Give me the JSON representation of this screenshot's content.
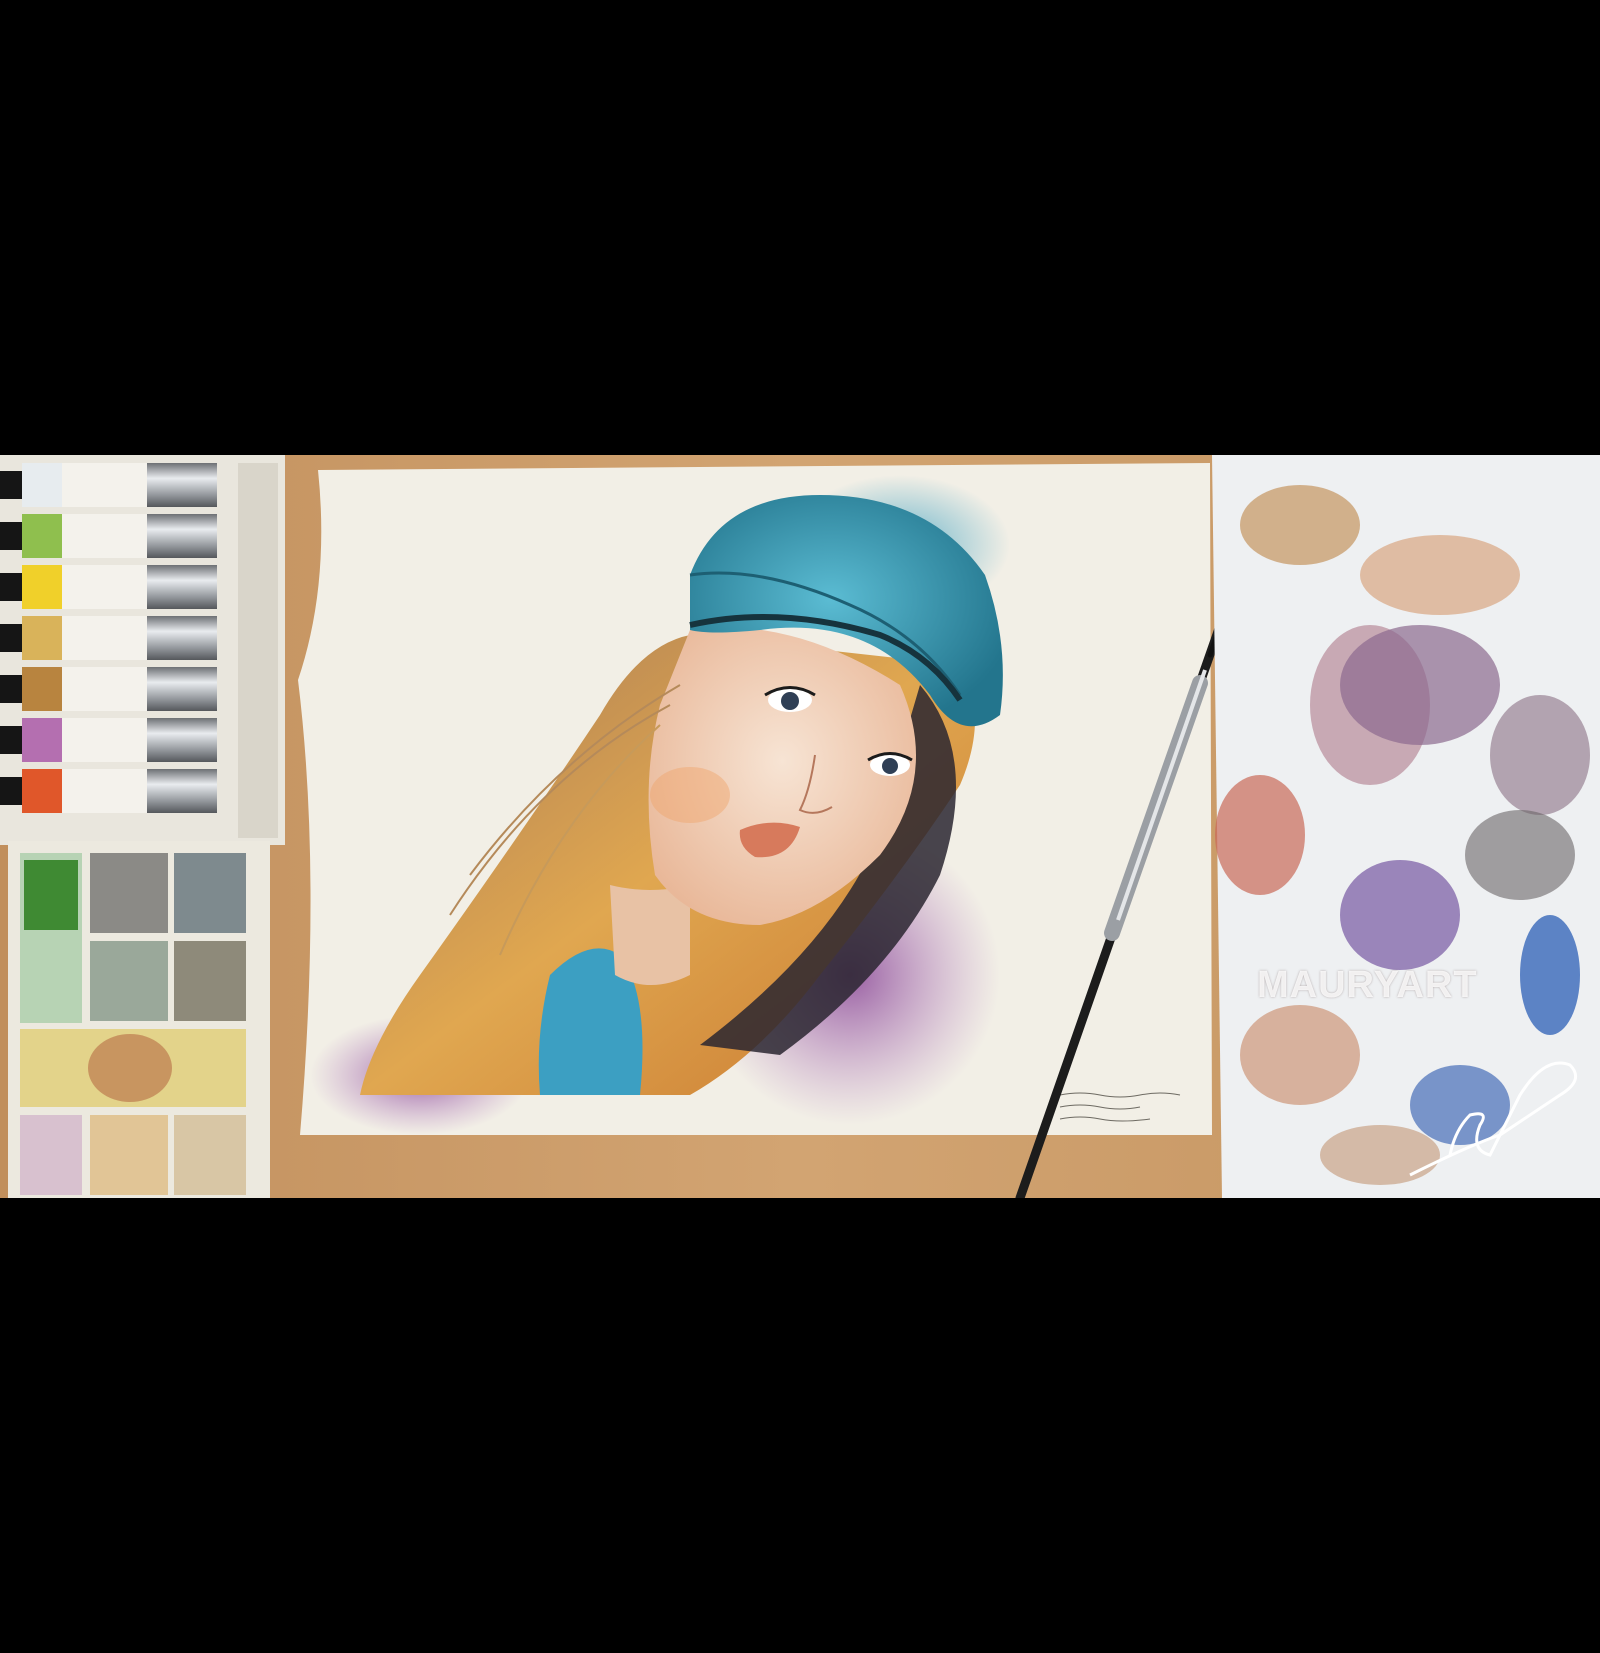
{
  "watermark": {
    "text": "MAURYART"
  },
  "signature": {
    "description": "handwritten-signature"
  },
  "paint_tubes": [
    {
      "color": "#e7ecef",
      "name": "white-tube"
    },
    {
      "color": "#8fbf4e",
      "name": "green-tube"
    },
    {
      "color": "#f0d02a",
      "name": "yellow-tube"
    },
    {
      "color": "#d9b35a",
      "name": "ochre-tube"
    },
    {
      "color": "#b8843f",
      "name": "brown-tube"
    },
    {
      "color": "#b46fb0",
      "name": "violet-tube"
    },
    {
      "color": "#e0572a",
      "name": "orange-tube"
    }
  ],
  "colors": {
    "background": "#000000",
    "desk": "#c99a66",
    "paper": "#f1efe7",
    "cap": "#3fa1bb",
    "hair": "#d7a24f",
    "purple_wash": "#9b5fa5"
  }
}
